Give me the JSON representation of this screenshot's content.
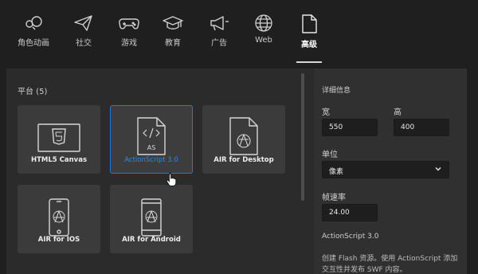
{
  "tabs": [
    {
      "label": "角色动画",
      "icon": "character-icon"
    },
    {
      "label": "社交",
      "icon": "paper-plane-icon"
    },
    {
      "label": "游戏",
      "icon": "gamepad-icon"
    },
    {
      "label": "教育",
      "icon": "graduation-cap-icon"
    },
    {
      "label": "广告",
      "icon": "megaphone-icon"
    },
    {
      "label": "Web",
      "icon": "globe-icon"
    },
    {
      "label": "高级",
      "icon": "document-icon",
      "active": true
    }
  ],
  "platform": {
    "title": "平台 (5)",
    "cards": [
      {
        "label": "HTML5 Canvas",
        "icon": "html5-icon"
      },
      {
        "label": "ActionScript 3.0",
        "icon": "actionscript-file-icon",
        "badge": "AS",
        "selected": true
      },
      {
        "label": "AIR for Desktop",
        "icon": "air-desktop-icon"
      },
      {
        "label": "AIR for IOS",
        "icon": "air-ios-icon"
      },
      {
        "label": "AIR for Android",
        "icon": "air-android-icon"
      }
    ]
  },
  "details": {
    "title": "详细信息",
    "width_label": "宽",
    "width_value": "550",
    "height_label": "高",
    "height_value": "400",
    "unit_label": "单位",
    "unit_value": "像素",
    "fps_label": "帧速率",
    "fps_value": "24.00",
    "heading": "ActionScript 3.0",
    "description": "创建 Flash 资源。使用 ActionScript 添加交互性并发布 SWF 内容。"
  },
  "colors": {
    "accent": "#1e7bd9",
    "background": "#1f1f1f",
    "panel": "#2b2b2b",
    "card": "#3b3b3b"
  }
}
